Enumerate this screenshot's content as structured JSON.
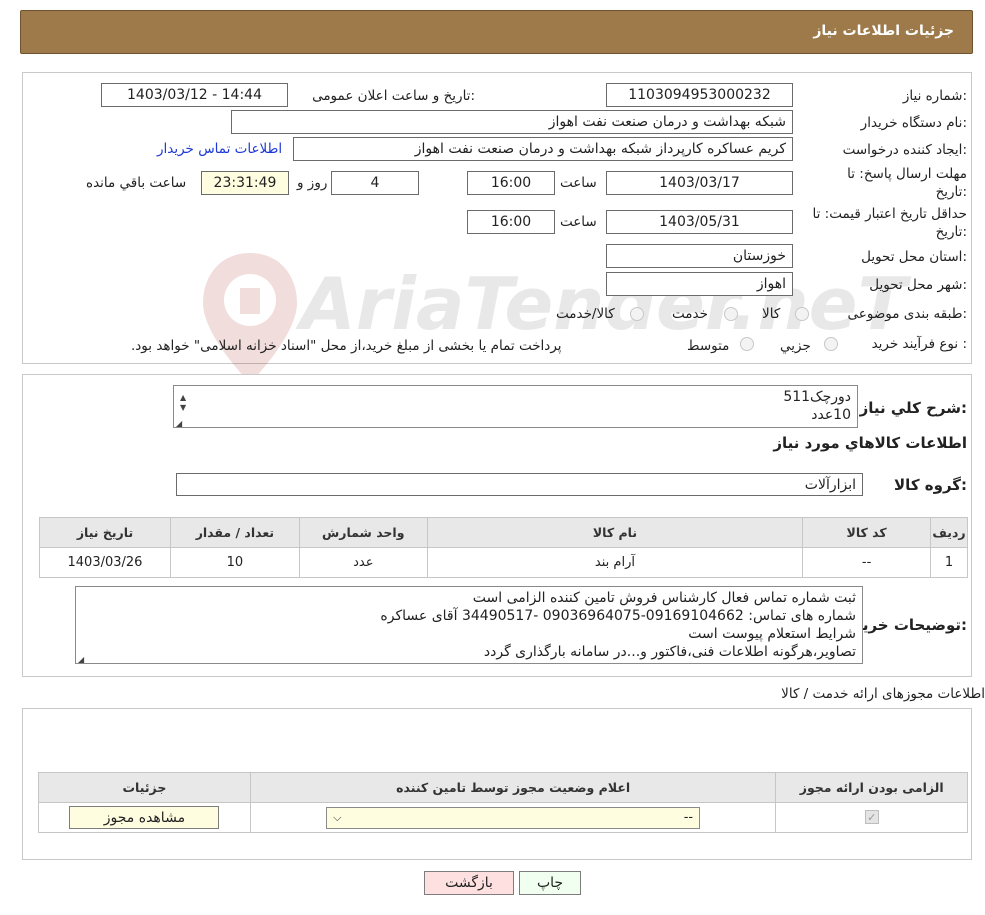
{
  "header": {
    "title": "جزئیات اطلاعات نیاز"
  },
  "form": {
    "need_number_label": "شماره نیاز:",
    "need_number": "1103094953000232",
    "announce_label": "تاریخ و ساعت اعلان عمومی:",
    "announce_value": "1403/03/12 - 14:44",
    "buyer_org_label": "نام دستگاه خریدار:",
    "buyer_org": "شبکه بهداشت و درمان صنعت نفت اهواز",
    "creator_label": "ایجاد کننده درخواست:",
    "creator": "کریم عساکره کارپرداز شبکه بهداشت و درمان صنعت نفت اهواز",
    "contact_link": "اطلاعات تماس خریدار",
    "deadline_label_1": "مهلت ارسال پاسخ: تا",
    "deadline_label_2": "تاریخ:",
    "deadline_date": "1403/03/17",
    "time_label": "ساعت",
    "deadline_time": "16:00",
    "days_value": "4",
    "days_label": "روز و",
    "remaining_value": "23:31:49",
    "remaining_label": "ساعت باقي مانده",
    "validity_label_1": "حداقل تاريخ اعتبار قيمت: تا",
    "validity_label_2": "تاريخ:",
    "validity_date": "1403/05/31",
    "validity_time": "16:00",
    "province_label": "استان محل تحویل:",
    "province": "خوزستان",
    "city_label": "شهر محل تحویل:",
    "city": "اهواز",
    "category_label": "طبقه بندی موضوعی:",
    "category_options": [
      "کالا",
      "خدمت",
      "کالا/خدمت"
    ],
    "process_label": "نوع فرآیند خرید :",
    "process_options": [
      "جزیي",
      "متوسط"
    ],
    "process_note": "پرداخت تمام یا بخشی از مبلغ خرید،از محل \"اسناد خزانه اسلامی\" خواهد بود."
  },
  "details": {
    "summary_label": "شرح كلي نياز:",
    "summary_lines": [
      "دورچک511",
      "10عدد"
    ],
    "goods_info_title": "اطلاعات كالاهاي مورد نياز",
    "group_label": "گروه كالا:",
    "group_value": "ابزارآلات",
    "table_headers": [
      "رديف",
      "كد كالا",
      "نام كالا",
      "واحد شمارش",
      "تعداد / مقدار",
      "تاريخ نياز"
    ],
    "table_rows": [
      [
        "1",
        "--",
        "آرام بند",
        "عدد",
        "10",
        "1403/03/26"
      ]
    ],
    "buyer_notes_label": "توضیحات خریدار:",
    "buyer_notes": [
      "ثبت شماره تماس فعال کارشناس فروش تامین کننده الزامی است",
      "شماره های تماس: 09169104662-09036964075 -34490517 آقای عساکره",
      "شرایط استعلام پیوست است",
      "تصاویر،هرگونه اطلاعات فنی،فاکتور و...در سامانه بارگذاری گردد"
    ]
  },
  "permits": {
    "title": "اطلاعات مجوزهای ارائه خدمت / کالا",
    "headers": [
      "الزامی بودن ارائه مجوز",
      "اعلام وضعیت مجوز توسط تامین کننده",
      "جزئیات"
    ],
    "select_value": "--",
    "view_button": "مشاهده مجوز"
  },
  "buttons": {
    "print": "چاپ",
    "back": "بازگشت"
  },
  "watermark": {
    "text": "AriaTender.neT"
  }
}
